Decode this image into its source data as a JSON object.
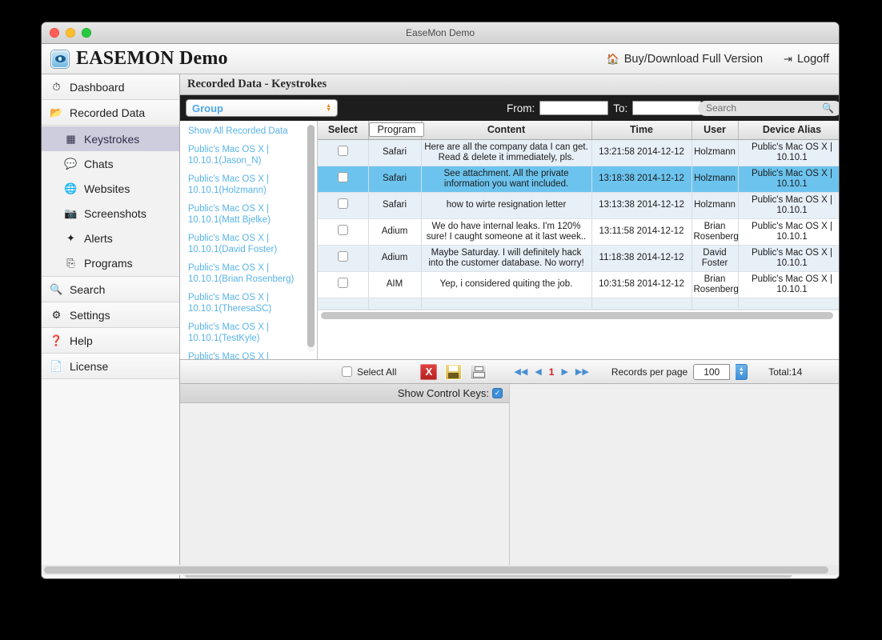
{
  "window": {
    "title": "EaseMon Demo"
  },
  "header": {
    "brand_title": "EASEMON Demo",
    "brand_icon": "eye-logo-icon",
    "buy_label": "Buy/Download Full Version",
    "buy_icon": "home-icon",
    "logoff_label": "Logoff",
    "logoff_icon": "exit-icon"
  },
  "sidebar": {
    "items": [
      {
        "label": "Dashboard",
        "icon": "gauge-icon",
        "selected": false
      },
      {
        "label": "Recorded Data",
        "icon": "folder-icon",
        "selected": false
      }
    ],
    "sub_items": [
      {
        "label": "Keystrokes",
        "icon": "keyboard-grid-icon",
        "selected": true
      },
      {
        "label": "Chats",
        "icon": "chat-bubble-icon",
        "selected": false
      },
      {
        "label": "Websites",
        "icon": "globe-icon",
        "selected": false
      },
      {
        "label": "Screenshots",
        "icon": "camera-icon",
        "selected": false
      },
      {
        "label": "Alerts",
        "icon": "wand-icon",
        "selected": false
      },
      {
        "label": "Programs",
        "icon": "app-window-icon",
        "selected": false
      }
    ],
    "bottom_items": [
      {
        "label": "Search",
        "icon": "magnifier-icon"
      },
      {
        "label": "Settings",
        "icon": "gear-icon"
      },
      {
        "label": "Help",
        "icon": "question-circle-icon"
      },
      {
        "label": "License",
        "icon": "license-card-icon"
      }
    ]
  },
  "page": {
    "title": "Recorded Data - Keystrokes"
  },
  "filterbar": {
    "group_label": "Group",
    "group_stepper_icon": "updown-stepper-icon",
    "from_label": "From:",
    "from_value": "",
    "to_label": "To:",
    "to_value": "",
    "search_placeholder": "Search",
    "search_value": "",
    "search_icon": "magnifier-icon"
  },
  "grouplist": {
    "entries": [
      "Show All Recorded Data",
      "Public's Mac OS X | 10.10.1(Jason_N)",
      "Public's Mac OS X | 10.10.1(Holzmann)",
      "Public's Mac OS X | 10.10.1(Matt Bjelke)",
      "Public's Mac OS X | 10.10.1(David Foster)",
      "Public's Mac OS X | 10.10.1(Brian Rosenberg)",
      "Public's Mac OS X | 10.10.1(TheresaSC)",
      "Public's Mac OS X | 10.10.1(TestKyle)",
      "Public's Mac OS X |"
    ]
  },
  "table": {
    "columns": [
      "Select",
      "Program",
      "Content",
      "Time",
      "User",
      "Device Alias"
    ],
    "rows": [
      {
        "program": "Safari",
        "content": "Here are all the company data I can get. Read & delete it immediately, pls.",
        "time": "13:21:58 2014-12-12",
        "user": "Holzmann",
        "device": "Public's Mac OS X | 10.10.1",
        "selected": false,
        "checked": false
      },
      {
        "program": "Safari",
        "content": "See attachment. All the private information you want included.",
        "time": "13:18:38 2014-12-12",
        "user": "Holzmann",
        "device": "Public's Mac OS X | 10.10.1",
        "selected": true,
        "checked": false
      },
      {
        "program": "Safari",
        "content": "how to wirte resignation letter",
        "time": "13:13:38 2014-12-12",
        "user": "Holzmann",
        "device": "Public's Mac OS X | 10.10.1",
        "selected": false,
        "checked": false
      },
      {
        "program": "Adium",
        "content": "We do have internal leaks. I'm 120% sure! I caught someone at it last week..",
        "time": "13:11:58 2014-12-12",
        "user": "Brian Rosenberg",
        "device": "Public's Mac OS X | 10.10.1",
        "selected": false,
        "checked": false
      },
      {
        "program": "Adium",
        "content": "Maybe Saturday. I will definitely hack into the customer database. No worry!",
        "time": "11:18:38 2014-12-12",
        "user": "David Foster",
        "device": "Public's Mac OS X | 10.10.1",
        "selected": false,
        "checked": false
      },
      {
        "program": "AIM",
        "content": "Yep, i considered quiting the job.",
        "time": "10:31:58 2014-12-12",
        "user": "Brian Rosenberg",
        "device": "Public's Mac OS X | 10.10.1",
        "selected": false,
        "checked": false
      }
    ]
  },
  "footer": {
    "select_all_label": "Select All",
    "export_excel_icon": "excel-export-icon",
    "save_icon": "floppy-save-icon",
    "print_icon": "printer-icon",
    "first_page_icon": "first-page-icon",
    "prev_page_icon": "prev-page-icon",
    "current_page": "1",
    "next_page_icon": "next-page-icon",
    "last_page_icon": "last-page-icon",
    "records_per_page_label": "Records per page",
    "records_per_page_value": "100",
    "total_label": "Total:14"
  },
  "detail": {
    "show_control_keys_label": "Show Control Keys:",
    "show_control_keys_checked": true,
    "checkmark": "✓",
    "content": ""
  },
  "colors": {
    "accent_blue": "#58b4e8",
    "row_selected": "#6cc4ee",
    "row_alt": "#e7eff7",
    "page_number_red": "#cc2222",
    "stepper_orange": "#f08a18"
  }
}
